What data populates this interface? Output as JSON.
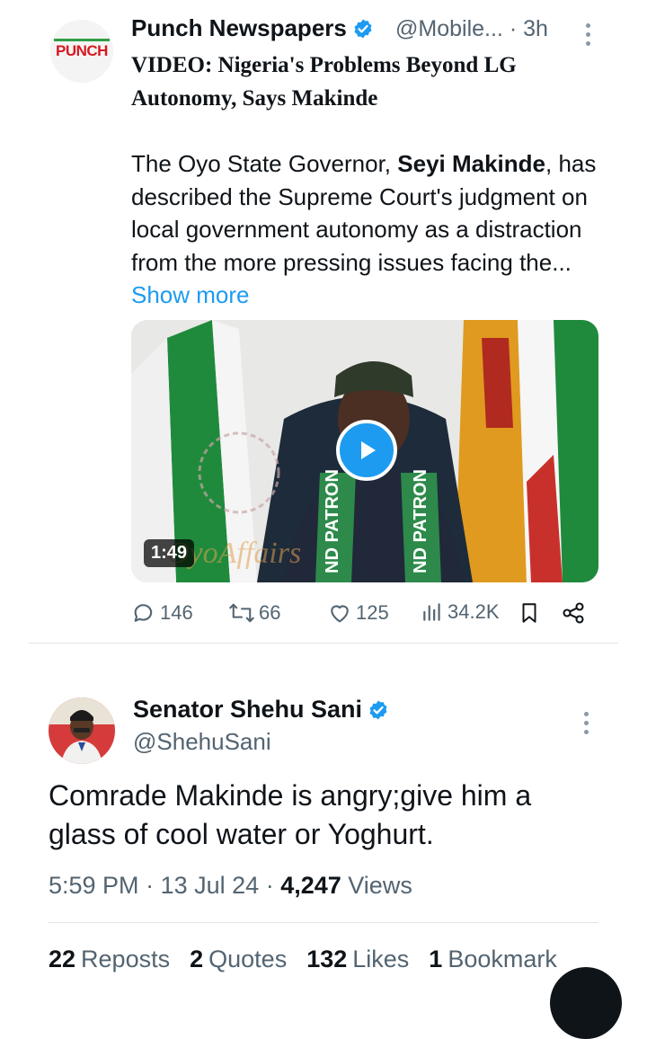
{
  "quoted": {
    "author_name": "Punch Newspapers",
    "handle": "@Mobile...",
    "time": "· 3h",
    "avatar_logo": "PUNCH",
    "headline": "VIDEO: Nigeria's Problems Beyond LG Autonomy, Says Makinde",
    "body_part1": "The Oyo State Governor, ",
    "body_bold": "Seyi Makinde",
    "body_part2": ", has described the Supreme Court's judgment on local government autonomy as a distraction from the more pressing issues facing the... ",
    "show_more": "Show more",
    "video_duration": "1:49",
    "watermark": "OyoAffairs",
    "sash_text": "ND PATRON",
    "replies": "146",
    "reposts": "66",
    "likes": "125",
    "views": "34.2K"
  },
  "tweet": {
    "author_name": "Senator Shehu Sani",
    "handle": "@ShehuSani",
    "text": "Comrade Makinde is angry;give him a glass of cool water or Yoghurt.",
    "time": "5:59 PM",
    "date": "13 Jul 24",
    "views_count": "4,247",
    "views_label": "Views",
    "reposts_count": "22",
    "reposts_label": "Reposts",
    "quotes_count": "2",
    "quotes_label": "Quotes",
    "likes_count": "132",
    "likes_label": "Likes",
    "bookmarks_count": "1",
    "bookmarks_label": "Bookmark"
  },
  "colors": {
    "accent": "#1d9bf0",
    "text": "#0f1419",
    "muted": "#536471",
    "punch_red": "#d71920"
  },
  "icons": [
    "verified-badge-icon",
    "more-options-icon",
    "play-icon",
    "reply-icon",
    "repost-icon",
    "like-icon",
    "views-icon",
    "bookmark-icon",
    "share-icon"
  ]
}
